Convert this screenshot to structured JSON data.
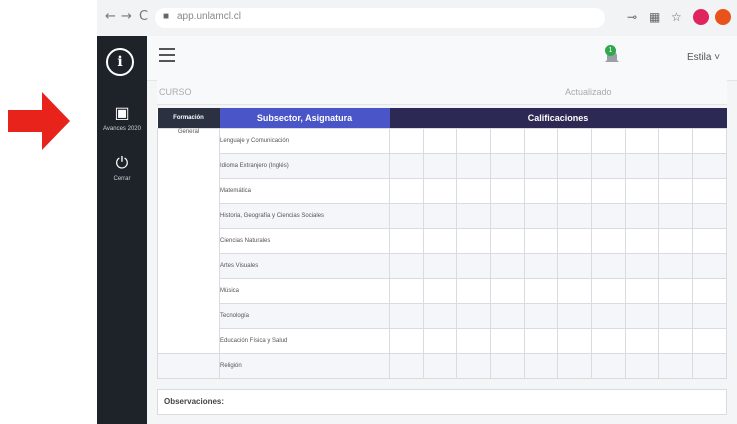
{
  "browser": {
    "url": "app.unlamcl.cl",
    "back_glyph": "←",
    "forward_glyph": "→",
    "reload_glyph": "C"
  },
  "sidebar": {
    "logo_letter": "i",
    "items": [
      {
        "label": "Avances 2020",
        "icon": "calendar-icon",
        "glyph": "▣"
      },
      {
        "label": "Cerrar",
        "icon": "power-icon",
        "glyph": "⏻"
      }
    ]
  },
  "topbar": {
    "notification_count": "1",
    "user_name": "Estila ˅"
  },
  "info": {
    "curso_label": "CURSO",
    "actualizado_label": "Actualizado"
  },
  "table": {
    "headers": {
      "formacion": "Formación",
      "subsector": "Subsector, Asignatura",
      "calificaciones": "Calificaciones"
    },
    "formacion_value": "General",
    "subjects": [
      "Lenguaje y Comunicación",
      "Idioma Extranjero (Inglés)",
      "Matemática",
      "Historia, Geografía y Ciencias Sociales",
      "Ciencias Naturales",
      "Artes Visuales",
      "Música",
      "Tecnología",
      "Educación Física y Salud",
      "Religión"
    ],
    "grade_columns": 10
  },
  "observaciones_label": "Observaciones:",
  "colors": {
    "sidebar": "#1e2329",
    "header_formacion": "#2c3142",
    "header_subsector": "#4a55c8",
    "header_calificaciones": "#2c2a55",
    "arrow": "#e8231b"
  }
}
